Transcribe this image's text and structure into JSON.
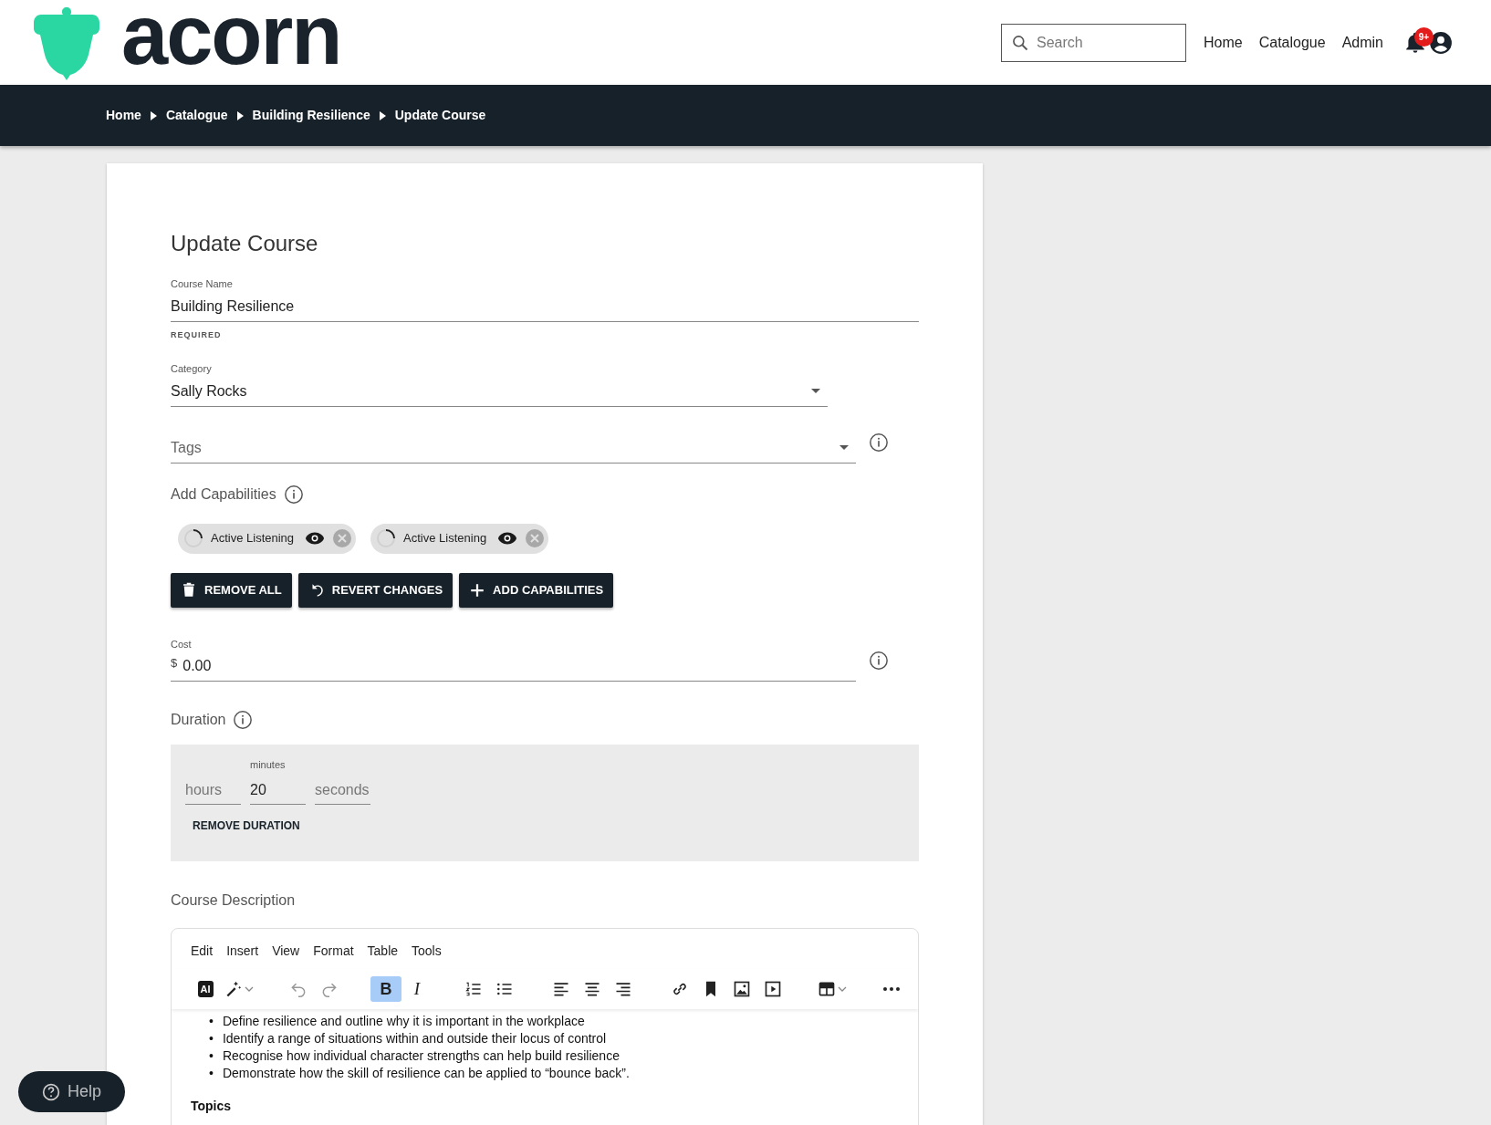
{
  "header": {
    "logo_text": "acorn",
    "search": {
      "placeholder": "Search"
    },
    "nav": [
      {
        "label": "Home"
      },
      {
        "label": "Catalogue"
      },
      {
        "label": "Admin"
      }
    ],
    "notifications_badge": "9+"
  },
  "breadcrumb": [
    {
      "label": "Home"
    },
    {
      "label": "Catalogue"
    },
    {
      "label": "Building Resilience"
    },
    {
      "label": "Update Course"
    }
  ],
  "form": {
    "title": "Update Course",
    "course_name": {
      "label": "Course Name",
      "value": "Building Resilience",
      "helper": "REQUIRED"
    },
    "category": {
      "label": "Category",
      "value": "Sally Rocks"
    },
    "tags": {
      "placeholder": "Tags"
    },
    "capabilities": {
      "label": "Add Capabilities",
      "chips": [
        {
          "label": "Active Listening"
        },
        {
          "label": "Active Listening"
        }
      ],
      "buttons": [
        {
          "kind": "trash",
          "label": "REMOVE ALL"
        },
        {
          "kind": "revert",
          "label": "REVERT CHANGES"
        },
        {
          "kind": "add",
          "label": "ADD CAPABILITIES"
        }
      ]
    },
    "cost": {
      "label": "Cost",
      "prefix": "$",
      "value": "0.00"
    },
    "duration": {
      "label": "Duration",
      "hours": {
        "placeholder": "hours"
      },
      "minutes": {
        "label": "minutes",
        "value": "20"
      },
      "seconds": {
        "placeholder": "seconds"
      },
      "remove_button": "REMOVE DURATION"
    },
    "description": {
      "label": "Course Description",
      "menu": [
        {
          "label": "Edit"
        },
        {
          "label": "Insert"
        },
        {
          "label": "View"
        },
        {
          "label": "Format"
        },
        {
          "label": "Table"
        },
        {
          "label": "Tools"
        }
      ],
      "toolbar": [
        {
          "kind": "ai",
          "label": "AI",
          "active": false
        },
        {
          "kind": "wand",
          "active": false
        },
        {
          "kind": "undo",
          "active": false
        },
        {
          "kind": "redo",
          "active": false
        },
        {
          "kind": "bold",
          "label": "B",
          "active": true
        },
        {
          "kind": "italic",
          "label": "I",
          "active": false
        },
        {
          "kind": "ol",
          "active": false
        },
        {
          "kind": "ul",
          "active": false
        },
        {
          "kind": "left",
          "active": false
        },
        {
          "kind": "center",
          "active": false
        },
        {
          "kind": "right",
          "active": false
        },
        {
          "kind": "link",
          "active": false
        },
        {
          "kind": "bookmark",
          "active": false
        },
        {
          "kind": "image",
          "active": false
        },
        {
          "kind": "media",
          "active": false
        },
        {
          "kind": "table",
          "active": false
        },
        {
          "kind": "more",
          "active": false
        }
      ],
      "bullets": [
        "Define resilience and outline why it is important in the workplace",
        "Identify a range of situations within and outside their locus of control",
        "Recognise how individual character strengths can help build resilience",
        "Demonstrate how the skill of resilience can be applied to “bounce back”."
      ],
      "bullet_marker": "•",
      "heading": "Topics"
    }
  },
  "help_button": "Help"
}
